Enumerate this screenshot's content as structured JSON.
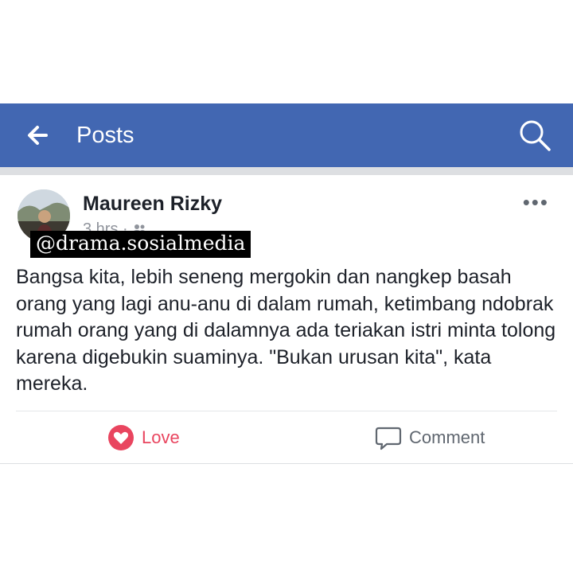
{
  "header": {
    "title": "Posts",
    "bar_color": "#4267b2",
    "back_icon": "arrow-left-icon",
    "search_icon": "search-icon"
  },
  "post": {
    "author": "Maureen Rizky",
    "timestamp": "3 hrs",
    "audience_icon": "friends-icon",
    "more_label": "•••",
    "body": "Bangsa kita, lebih seneng mergokin dan nangkep basah orang yang lagi anu-anu di dalam rumah, ketimbang ndobrak rumah orang yang di dalamnya ada teriakan istri minta tolong karena digebukin suaminya. \"Bukan urusan kita\", kata mereka."
  },
  "watermark": "@drama.sosialmedia",
  "actions": {
    "love_label": "Love",
    "love_color": "#e9455f",
    "love_icon": "heart-icon",
    "comment_label": "Comment",
    "comment_icon": "comment-bubble-icon"
  }
}
